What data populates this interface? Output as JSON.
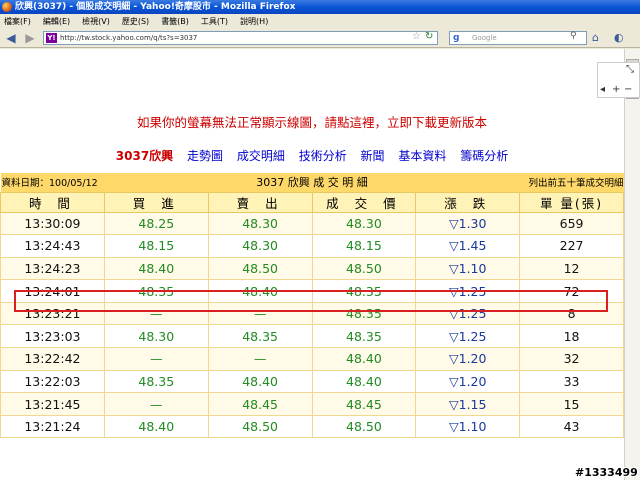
{
  "window": {
    "title": "欣興(3037) - 個股成交明細 - Yahoo!奇摩股市 - Mozilla Firefox"
  },
  "menu": [
    "檔案(F)",
    "編輯(E)",
    "檢視(V)",
    "歷史(S)",
    "書籤(B)",
    "工具(T)",
    "說明(H)"
  ],
  "nav": {
    "url": "http://tw.stock.yahoo.com/q/ts?s=3037",
    "search_placeholder": "Google"
  },
  "page": {
    "warning": "如果你的螢幕無法正常顯示線圖，請點這裡，立即下載更新版本",
    "subnav": [
      {
        "label": "3037欣興",
        "current": true
      },
      {
        "label": "走勢圖",
        "current": false
      },
      {
        "label": "成交明細",
        "current": false
      },
      {
        "label": "技術分析",
        "current": false
      },
      {
        "label": "新聞",
        "current": false
      },
      {
        "label": "基本資料",
        "current": false
      },
      {
        "label": "籌碼分析",
        "current": false
      }
    ],
    "table": {
      "date_label": "資料日期：100/05/12",
      "title": "3037 欣興 成 交 明 細",
      "note": "列出前五十筆成交明細",
      "columns": [
        "時 間",
        "買 進",
        "賣 出",
        "成 交 價",
        "漲 跌",
        "單 量(張)"
      ],
      "rows": [
        [
          "13:30:09",
          "48.25",
          "48.30",
          "48.30",
          "▽1.30",
          "659"
        ],
        [
          "13:24:43",
          "48.15",
          "48.30",
          "48.15",
          "▽1.45",
          "227"
        ],
        [
          "13:24:23",
          "48.40",
          "48.50",
          "48.50",
          "▽1.10",
          "12"
        ],
        [
          "13:24:01",
          "48.35",
          "48.40",
          "48.35",
          "▽1.25",
          "72"
        ],
        [
          "13:23:21",
          "—",
          "—",
          "48.35",
          "▽1.25",
          "8"
        ],
        [
          "13:23:03",
          "48.30",
          "48.35",
          "48.35",
          "▽1.25",
          "18"
        ],
        [
          "13:22:42",
          "—",
          "—",
          "48.40",
          "▽1.20",
          "32"
        ],
        [
          "13:22:03",
          "48.35",
          "48.40",
          "48.40",
          "▽1.20",
          "33"
        ],
        [
          "13:21:45",
          "—",
          "48.45",
          "48.45",
          "▽1.15",
          "15"
        ],
        [
          "13:21:24",
          "48.40",
          "48.50",
          "48.50",
          "▽1.10",
          "43"
        ]
      ]
    }
  },
  "watermark": "#1333499",
  "colors": {
    "header_bg": "#ffd86a",
    "price_green": "#228b22",
    "highlight_red": "#d82020",
    "warning_red": "#cc0000"
  }
}
